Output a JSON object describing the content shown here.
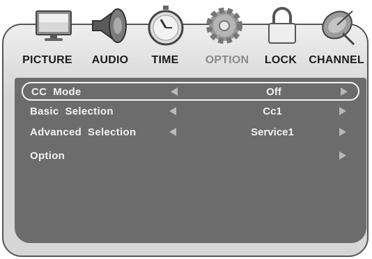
{
  "menu": {
    "tabs": [
      {
        "label": "PICTURE",
        "icon": "picture-icon"
      },
      {
        "label": "AUDIO",
        "icon": "speaker-icon"
      },
      {
        "label": "TIME",
        "icon": "stopwatch-icon"
      },
      {
        "label": "OPTION",
        "icon": "gear-icon"
      },
      {
        "label": "LOCK",
        "icon": "padlock-icon"
      },
      {
        "label": "CHANNEL",
        "icon": "satellite-dish-icon"
      }
    ],
    "active_tab": "OPTION"
  },
  "settings": {
    "rows": [
      {
        "label": "CC  Mode",
        "value": "Off",
        "selected": true,
        "has_left_arrow": true
      },
      {
        "label": "Basic  Selection",
        "value": "Cc1",
        "selected": false,
        "has_left_arrow": true
      },
      {
        "label": "Advanced  Selection",
        "value": "Service1",
        "selected": false,
        "has_left_arrow": true
      },
      {
        "label": "Option",
        "value": "",
        "selected": false,
        "has_left_arrow": false
      }
    ]
  },
  "colors": {
    "panel": "#6c6c6c",
    "frame_border": "#555555",
    "text_light": "#f2f2f2",
    "arrow": "#b9b9b9",
    "active_tab_text": "#8a8a8a"
  }
}
